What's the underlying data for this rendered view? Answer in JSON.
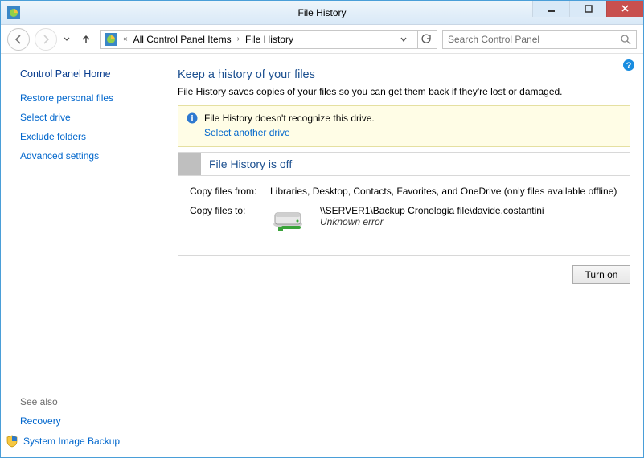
{
  "window": {
    "title": "File History"
  },
  "nav": {
    "breadcrumbs": [
      "All Control Panel Items",
      "File History"
    ],
    "search_placeholder": "Search Control Panel"
  },
  "sidebar": {
    "home": "Control Panel Home",
    "links": [
      "Restore personal files",
      "Select drive",
      "Exclude folders",
      "Advanced settings"
    ],
    "see_also_label": "See also",
    "see_also": [
      "Recovery",
      "System Image Backup"
    ]
  },
  "main": {
    "heading": "Keep a history of your files",
    "subtext": "File History saves copies of your files so you can get them back if they're lost or damaged.",
    "warning": {
      "text": "File History doesn't recognize this drive.",
      "link": "Select another drive"
    },
    "status_title": "File History is off",
    "copy_from_label": "Copy files from:",
    "copy_from_value": "Libraries, Desktop, Contacts, Favorites, and OneDrive (only files available offline)",
    "copy_to_label": "Copy files to:",
    "copy_to_path": "\\\\SERVER1\\Backup Cronologia file\\davide.costantini",
    "copy_to_error": "Unknown error",
    "turn_on_label": "Turn on"
  }
}
